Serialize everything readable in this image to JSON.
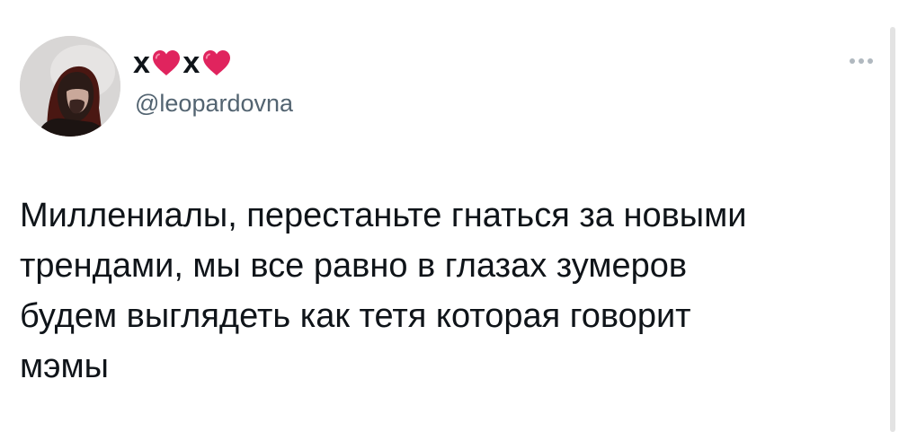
{
  "author": {
    "display_name_parts": [
      "x",
      "x"
    ],
    "display_name_icons": [
      "red-heart-icon",
      "red-heart-icon"
    ],
    "handle": "@leopardovna"
  },
  "menu": {
    "icon": "more-horizontal-icon"
  },
  "tweet": {
    "text_lines": [
      "Миллениалы, перестаньте гнаться за новыми",
      "трендами, мы все равно в глазах зумеров",
      "будем выглядеть как тетя которая говорит",
      "мэмы"
    ]
  },
  "colors": {
    "heart": "#e0245e",
    "handle": "#536471",
    "text": "#0f1419"
  }
}
